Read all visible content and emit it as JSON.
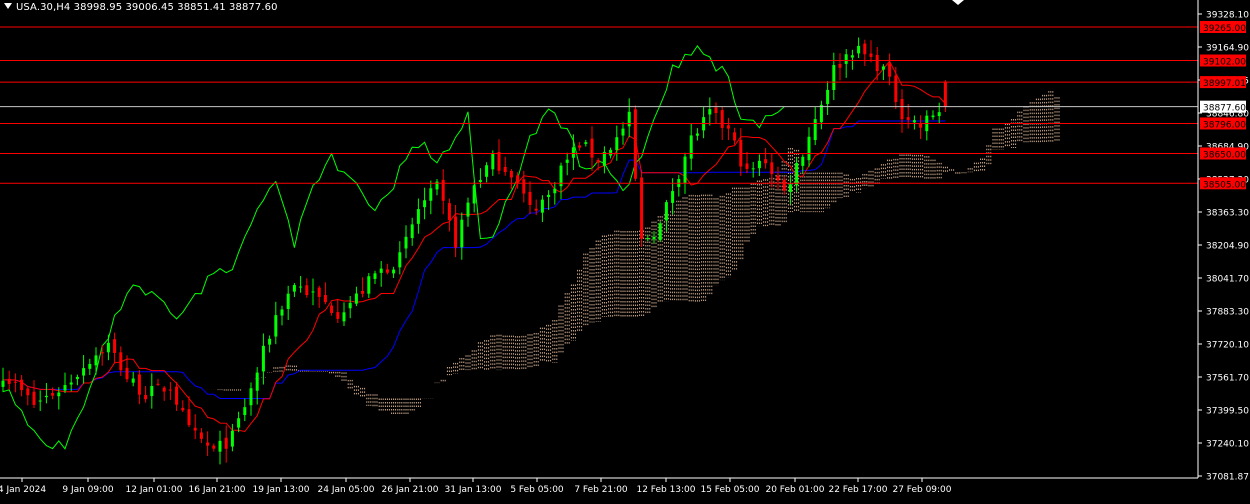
{
  "chart_data": {
    "type": "candlestick",
    "title": "USA.30,H4  38998.95 39006.45 38851.41 38877.60",
    "symbol": "USA.30",
    "timeframe": "H4",
    "ohlc_readout": {
      "open": 38998.95,
      "high": 39006.45,
      "low": 38851.41,
      "close": 38877.6
    },
    "current_price": "38877.60",
    "ylim": [
      37081.87,
      39328.1
    ],
    "y_ticks": [
      "39328.10",
      "39164.90",
      "39006.45",
      "38846.80",
      "38684.90",
      "38527.30",
      "38363.30",
      "38204.90",
      "38041.70",
      "37883.30",
      "37720.10",
      "37561.70",
      "37399.50",
      "37240.10",
      "37081.87"
    ],
    "x_ticks": [
      "4 Jan 2024",
      "9 Jan 09:00",
      "12 Jan 01:00",
      "16 Jan 21:00",
      "19 Jan 13:00",
      "24 Jan 05:00",
      "26 Jan 21:00",
      "31 Jan 13:00",
      "5 Feb 05:00",
      "7 Feb 21:00",
      "12 Feb 13:00",
      "15 Feb 05:00",
      "20 Feb 01:00",
      "22 Feb 17:00",
      "27 Feb 09:00"
    ],
    "levels": [
      {
        "label": "39265.00",
        "value": 39265.0
      },
      {
        "label": "39102.00",
        "value": 39102.0
      },
      {
        "label": "38997.01",
        "value": 38997.01
      },
      {
        "label": "38796.00",
        "value": 38796.0
      },
      {
        "label": "38650.00",
        "value": 38650.0
      },
      {
        "label": "38505.00",
        "value": 38505.0
      }
    ],
    "anchors": [
      [
        0,
        37580
      ],
      [
        5,
        37430
      ],
      [
        10,
        37520
      ],
      [
        14,
        37650
      ],
      [
        17,
        37720
      ],
      [
        20,
        37560
      ],
      [
        23,
        37480
      ],
      [
        27,
        37520
      ],
      [
        30,
        37300
      ],
      [
        34,
        37200
      ],
      [
        37,
        37270
      ],
      [
        40,
        37500
      ],
      [
        44,
        37860
      ],
      [
        47,
        38020
      ],
      [
        50,
        37960
      ],
      [
        54,
        37880
      ],
      [
        57,
        37950
      ],
      [
        60,
        38060
      ],
      [
        64,
        38140
      ],
      [
        67,
        38380
      ],
      [
        70,
        38480
      ],
      [
        73,
        38220
      ],
      [
        76,
        38500
      ],
      [
        79,
        38620
      ],
      [
        82,
        38560
      ],
      [
        85,
        38380
      ],
      [
        88,
        38440
      ],
      [
        90,
        38580
      ],
      [
        93,
        38700
      ],
      [
        96,
        38620
      ],
      [
        99,
        38720
      ],
      [
        101,
        38820
      ],
      [
        103,
        38220
      ],
      [
        106,
        38300
      ],
      [
        108,
        38480
      ],
      [
        111,
        38720
      ],
      [
        114,
        38840
      ],
      [
        117,
        38760
      ],
      [
        120,
        38550
      ],
      [
        123,
        38620
      ],
      [
        126,
        38460
      ],
      [
        129,
        38660
      ],
      [
        132,
        38900
      ],
      [
        134,
        39060
      ],
      [
        137,
        39160
      ],
      [
        139,
        39130
      ],
      [
        142,
        39060
      ],
      [
        145,
        38850
      ],
      [
        148,
        38780
      ],
      [
        150,
        38840
      ],
      [
        152,
        38880
      ]
    ],
    "series": [
      {
        "name": "Kijun-sen",
        "color": "#0000ff"
      },
      {
        "name": "Tenkan-sen",
        "color": "#ff0000"
      },
      {
        "name": "Chikou Span",
        "color": "#00ff00"
      },
      {
        "name": "Kumo",
        "color": "#f5c9a8"
      }
    ],
    "colors": {
      "bull": "#00ff00",
      "bear": "#ff0000",
      "level": "#ff0000",
      "level_box": "#ff0000",
      "current": "#ffffff",
      "axis_text": "#ffffff"
    }
  }
}
